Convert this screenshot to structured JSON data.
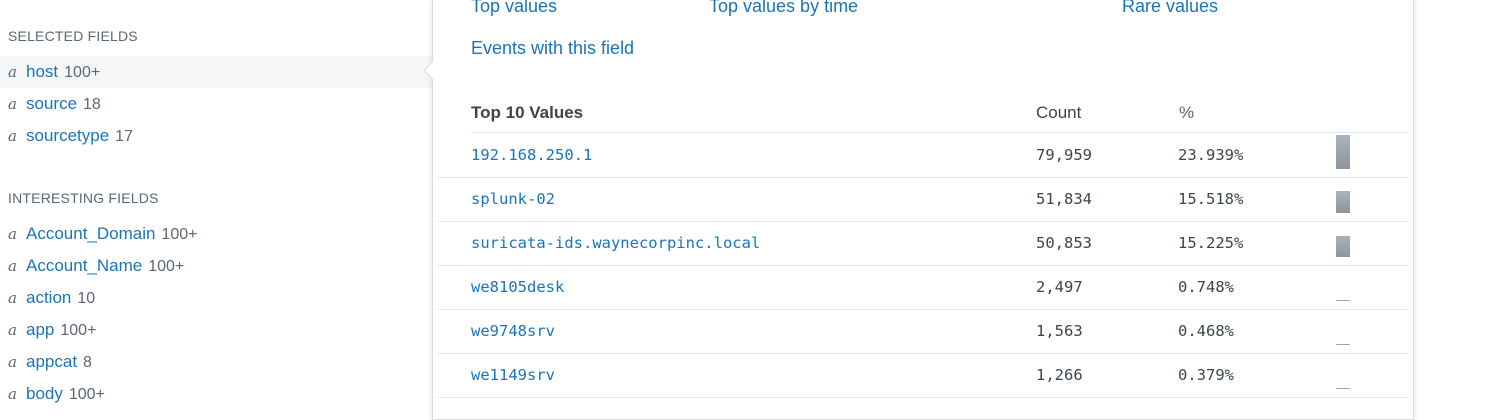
{
  "sidebar": {
    "selected_title": "SELECTED FIELDS",
    "selected": [
      {
        "type": "a",
        "name": "host",
        "count": "100+"
      },
      {
        "type": "a",
        "name": "source",
        "count": "18"
      },
      {
        "type": "a",
        "name": "sourcetype",
        "count": "17"
      }
    ],
    "interesting_title": "INTERESTING FIELDS",
    "interesting": [
      {
        "type": "a",
        "name": "Account_Domain",
        "count": "100+"
      },
      {
        "type": "a",
        "name": "Account_Name",
        "count": "100+"
      },
      {
        "type": "a",
        "name": "action",
        "count": "10"
      },
      {
        "type": "a",
        "name": "app",
        "count": "100+"
      },
      {
        "type": "a",
        "name": "appcat",
        "count": "8"
      },
      {
        "type": "a",
        "name": "body",
        "count": "100+"
      }
    ]
  },
  "popover": {
    "links": {
      "top_values": "Top values",
      "top_values_by_time": "Top values by time",
      "rare_values": "Rare values",
      "events_with_field": "Events with this field"
    },
    "table": {
      "col_values": "Top 10 Values",
      "col_count": "Count",
      "col_percent": "%",
      "rows": [
        {
          "value": "192.168.250.1",
          "count": "79,959",
          "percent": "23.939%",
          "bar_fraction": 0.23939
        },
        {
          "value": "splunk-02",
          "count": "51,834",
          "percent": "15.518%",
          "bar_fraction": 0.15518
        },
        {
          "value": "suricata-ids.waynecorpinc.local",
          "count": "50,853",
          "percent": "15.225%",
          "bar_fraction": 0.15225
        },
        {
          "value": "we8105desk",
          "count": "2,497",
          "percent": "0.748%",
          "bar_fraction": 0.00748
        },
        {
          "value": "we9748srv",
          "count": "1,563",
          "percent": "0.468%",
          "bar_fraction": 0.00468
        },
        {
          "value": "we1149srv",
          "count": "1,266",
          "percent": "0.379%",
          "bar_fraction": 0.00379
        }
      ]
    }
  }
}
